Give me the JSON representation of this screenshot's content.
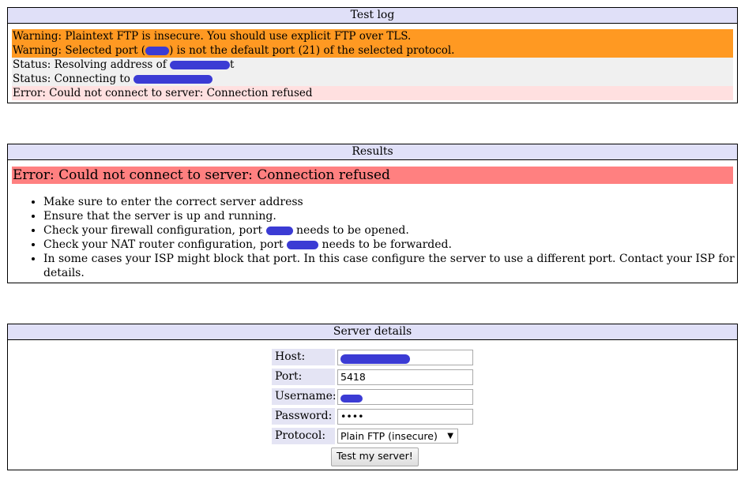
{
  "test_log": {
    "title": "Test log",
    "lines": [
      {
        "type": "warning",
        "text": "Warning: Plaintext FTP is insecure. You should use explicit FTP over TLS."
      },
      {
        "type": "warning",
        "pre": "Warning: Selected port (",
        "post": ") is not the default port (21) of the selected protocol."
      },
      {
        "type": "status",
        "pre": "Status: Resolving address of ",
        "post": "t"
      },
      {
        "type": "status",
        "pre": "Status: Connecting to ",
        "post": ""
      },
      {
        "type": "error",
        "text": "Error: Could not connect to server: Connection refused"
      }
    ]
  },
  "results": {
    "title": "Results",
    "error": "Error: Could not connect to server: Connection refused",
    "tips": [
      {
        "text": "Make sure to enter the correct server address"
      },
      {
        "text": "Ensure that the server is up and running."
      },
      {
        "pre": "Check your firewall configuration, port ",
        "post": " needs to be opened."
      },
      {
        "pre": "Check your NAT router configuration, port ",
        "post": " needs to be forwarded."
      },
      {
        "text": "In some cases your ISP might block that port. In this case configure the server to use a different port. Contact your ISP for details."
      }
    ]
  },
  "server_details": {
    "title": "Server details",
    "host_label": "Host:",
    "port_label": "Port:",
    "port_value": "5418",
    "username_label": "Username:",
    "password_label": "Password:",
    "password_mask": "••••",
    "protocol_label": "Protocol:",
    "protocol_value": "Plain FTP (insecure)",
    "test_button": "Test my server!"
  },
  "colors": {
    "header_bg": "#e0e0f8",
    "warning_bg": "#ff9922",
    "status_bg": "#f0f0f0",
    "error_bg": "#ffe0e0",
    "result_error_bg": "#ff8080",
    "redaction": "#3b3bd4"
  }
}
